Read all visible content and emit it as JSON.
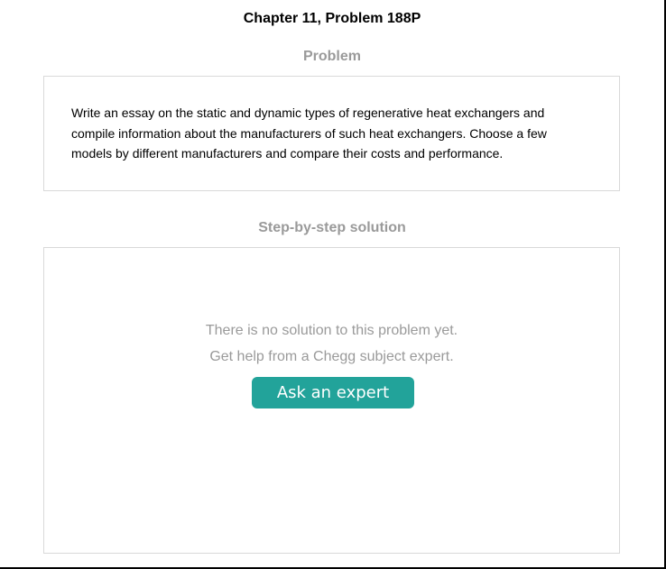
{
  "page": {
    "title": "Chapter 11, Problem 188P"
  },
  "problem": {
    "heading": "Problem",
    "text": "Write an essay on the static and dynamic types of regenerative heat exchangers and compile information about the manufacturers of such heat exchangers. Choose a few models by different manufacturers and compare their costs and performance."
  },
  "solution": {
    "heading": "Step-by-step solution",
    "message_line1": "There is no solution to this problem yet.",
    "message_line2": "Get help from a Chegg subject expert.",
    "button_label": "Ask an expert"
  },
  "colors": {
    "accent": "#22a39a",
    "muted_text": "#9a9a9a",
    "border": "#d9d9d9"
  }
}
